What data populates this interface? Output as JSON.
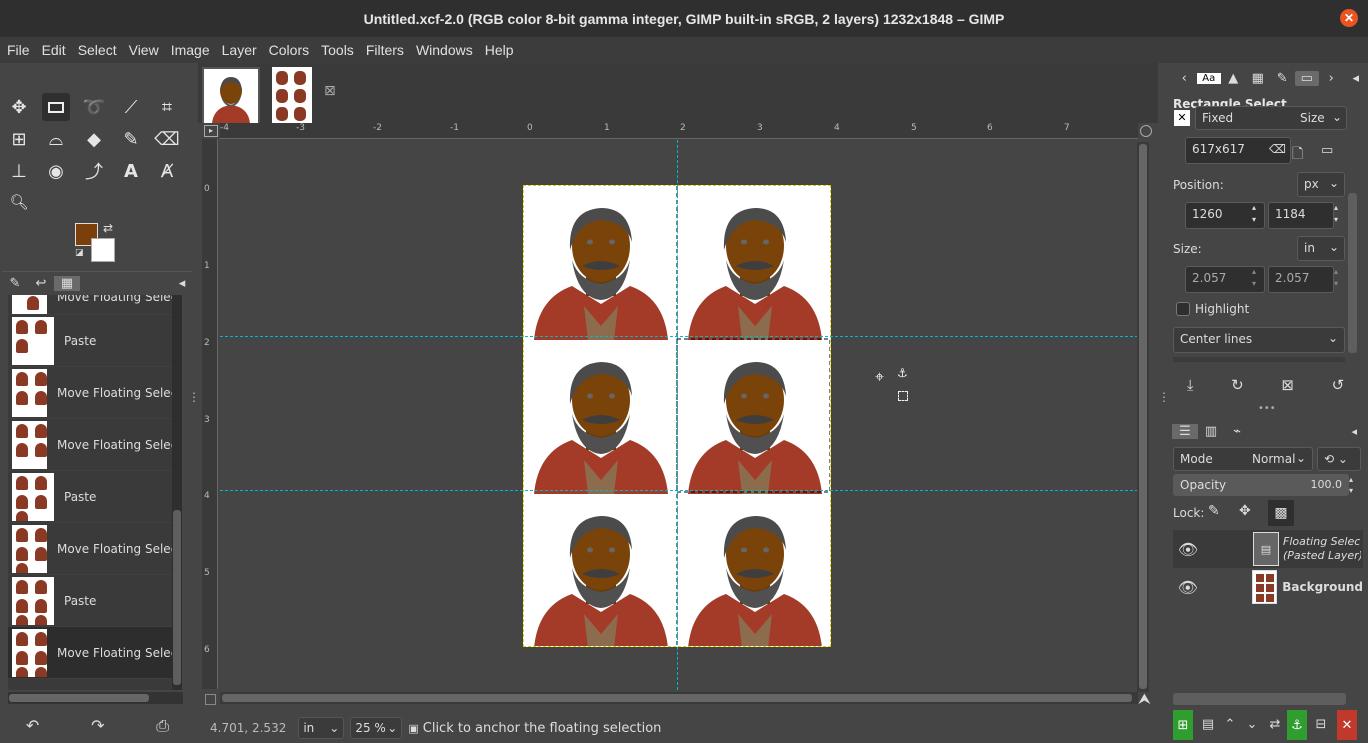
{
  "title": "Untitled.xcf-2.0 (RGB color 8-bit gamma integer, GIMP built-in sRGB, 2 layers) 1232x1848 – GIMP",
  "menu": [
    "File",
    "Edit",
    "Select",
    "View",
    "Image",
    "Layer",
    "Colors",
    "Tools",
    "Filters",
    "Windows",
    "Help"
  ],
  "history": [
    "Move Floating Select",
    "Paste",
    "Move Floating Select",
    "Move Floating Select",
    "Paste",
    "Move Floating Select",
    "Paste",
    "Move Floating Select"
  ],
  "ruler": {
    "h": [
      "-4",
      "-3",
      "-2",
      "-1",
      "0",
      "1",
      "2",
      "3",
      "4",
      "5",
      "6",
      "7"
    ],
    "v": [
      "0",
      "1",
      "2",
      "3",
      "4",
      "5",
      "6"
    ]
  },
  "status": {
    "coords": "4.701, 2.532",
    "unit": "in",
    "zoom": "25 %",
    "message": "Click to anchor the floating selection"
  },
  "tool_options": {
    "title": "Rectangle Select",
    "fixed": "Fixed",
    "size_mode": "Size",
    "fixed_value": "617x617",
    "position_label": "Position:",
    "position_unit": "px",
    "pos_x": "1260",
    "pos_y": "1184",
    "size_label": "Size:",
    "size_unit": "in",
    "size_w": "2.057",
    "size_h": "2.057",
    "highlight": "Highlight",
    "guides": "Center lines"
  },
  "layers_panel": {
    "mode_label": "Mode",
    "mode": "Normal",
    "opacity_label": "Opacity",
    "opacity": "100.0",
    "lock_label": "Lock:",
    "layers": [
      {
        "name": "Floating Selection (Posted Layer)",
        "name1": "Floating Selecti",
        "name2": "(Pasted Layer)"
      },
      {
        "name": "Background"
      }
    ]
  },
  "colors": {
    "fg": "#7a3f0a",
    "bg": "#ffffff",
    "guide": "#00b7d0",
    "selection": "#e0d000",
    "anchor": "#2f9e2f",
    "delete": "#c0392b"
  }
}
